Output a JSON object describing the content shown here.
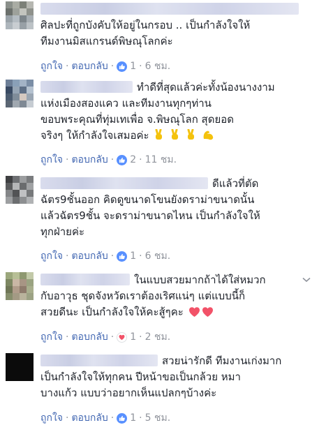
{
  "actions": {
    "like": "ถูกใจ",
    "reply": "ตอบกลับ",
    "dot": "·"
  },
  "comments": [
    {
      "lines": [
        "ศิลปะที่ถูกบังคับให้อยู่ในกรอบ .. เป็นกำลังใจให้",
        "ทีมงานมิสแกรนด์พิษณุโลกค่ะ"
      ],
      "reaction": "like-icon",
      "count": "1",
      "time": "6 ชม."
    },
    {
      "lines": [
        "ทำดีที่สุดแล้วค่ะทั้งน้องนางงาม",
        "แห่งเมืองสองแคว และทีมงานทุกๆท่าน",
        "ขอบพระคุณที่ทุ่มเทเพื่อ จ.พิษณุโลก สุดยอด",
        "จริงๆ ให้กำลังใจเสมอค่ะ"
      ],
      "reaction": "like-icon",
      "count": "2",
      "time": "11 ชม."
    },
    {
      "lines": [
        "ดีแล้วที่ตัด",
        "ฉัตร9ชั้นออก คิดดูขนาดโขนยังดราม่าขนาดนั้น",
        "แล้วฉัตร9ชั้น จะดราม่าขนาดไหน เป็นกำลังใจให้",
        "ทุกฝ่ายค่ะ"
      ],
      "reaction": "like-icon",
      "count": "1",
      "time": "6 ชม."
    },
    {
      "lines": [
        "ในแบบสวยมากถ้าได้ใส่หมวก",
        "กับอาวุธ ชุดจังหวัดเราต้องเริศแน่ๆ แต่แบบนี้ก็",
        "สวยดีนะ เป็นกำลังใจให้คะสู้ๆคะ"
      ],
      "reaction": "heart-icon",
      "count": "1",
      "time": "2 ชม."
    },
    {
      "lines": [
        "สวยน่ารักดี ทีมงานเก่งมาก",
        "เป็นกำลังใจให้ทุกคน ปีหน้าขอเป็นกล้วย หมา",
        "บางแก้ว แบบว่าอยากเห็นแปลกๆบ้างค่ะ"
      ],
      "reaction": "like-icon",
      "count": "1",
      "time": "5 ชม."
    }
  ],
  "colors": {
    "link": "#4267b2",
    "meta": "#90949c",
    "like": "#5890ff",
    "heart": "#f25268",
    "victory": "#f4c20d"
  }
}
